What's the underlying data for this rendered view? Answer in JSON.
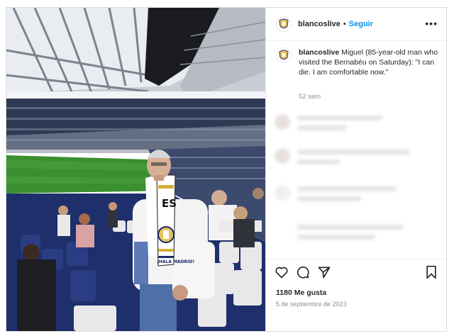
{
  "post": {
    "username": "blancoslive",
    "separator": "•",
    "follow_label": "Seguir",
    "more_label": "•••",
    "caption_user": "blancoslive",
    "caption_text": "Miguel (85-year-old man who visited the Bernabéu on Saturday): \"I can die. I am comfortable now.\"",
    "time_ago": "52 sem",
    "likes": "1180 Me gusta",
    "date": "5 de septiembre de 2023"
  },
  "photo": {
    "scarf_top": "ES",
    "scarf_bottom": "¡HALA MADRID!"
  },
  "colors": {
    "follow": "#0095f6",
    "text": "#262626",
    "muted": "#8e8e8e",
    "border": "#dbdbdb",
    "pitch": "#3a8f2f",
    "seats": "#1e2f6b"
  },
  "icons": [
    "real-madrid-crest-icon",
    "more-options-icon",
    "heart-icon",
    "comment-icon",
    "share-icon",
    "bookmark-icon"
  ]
}
